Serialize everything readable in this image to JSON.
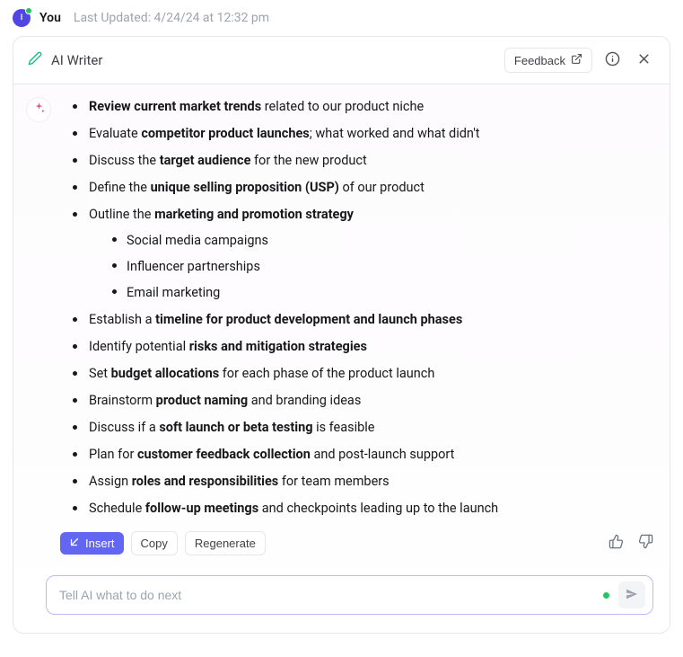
{
  "header": {
    "avatar_initial": "I",
    "you_label": "You",
    "updated_label": "Last Updated:  4/24/24 at 12:32 pm"
  },
  "panel": {
    "title": "AI Writer",
    "feedback_label": "Feedback"
  },
  "bullets": [
    {
      "pre": "",
      "bold": "Review current market trends",
      "post": " related to our product niche"
    },
    {
      "pre": "Evaluate ",
      "bold": "competitor product launches",
      "post": "; what worked and what didn't"
    },
    {
      "pre": "Discuss the ",
      "bold": "target audience",
      "post": " for the new product"
    },
    {
      "pre": "Define the ",
      "bold": "unique selling proposition (USP)",
      "post": " of our product"
    },
    {
      "pre": "Outline the ",
      "bold": "marketing and promotion strategy",
      "post": "",
      "sub": [
        "Social media campaigns",
        "Influencer partnerships",
        "Email marketing"
      ]
    },
    {
      "pre": "Establish a ",
      "bold": "timeline for product development and launch phases",
      "post": ""
    },
    {
      "pre": "Identify potential ",
      "bold": "risks and mitigation strategies",
      "post": ""
    },
    {
      "pre": "Set ",
      "bold": "budget allocations",
      "post": " for each phase of the product launch"
    },
    {
      "pre": "Brainstorm ",
      "bold": "product naming",
      "post": " and branding ideas"
    },
    {
      "pre": "Discuss if a ",
      "bold": "soft launch or beta testing",
      "post": " is feasible"
    },
    {
      "pre": "Plan for ",
      "bold": "customer feedback collection",
      "post": " and post-launch support"
    },
    {
      "pre": "Assign ",
      "bold": "roles and responsibilities",
      "post": " for team members"
    },
    {
      "pre": "Schedule ",
      "bold": "follow-up meetings",
      "post": " and checkpoints leading up to the launch"
    }
  ],
  "actions": {
    "insert_label": "Insert",
    "copy_label": "Copy",
    "regenerate_label": "Regenerate"
  },
  "input": {
    "placeholder": "Tell AI what to do next"
  }
}
